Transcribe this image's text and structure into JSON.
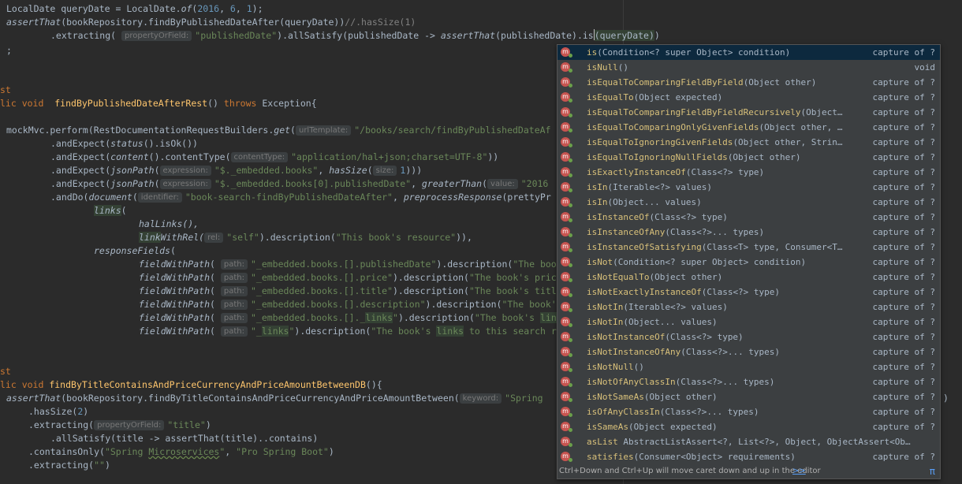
{
  "code": {
    "l1_a": "LocalDate queryDate = LocalDate.",
    "l1_b": "of",
    "l1_c": "(",
    "l1_n1": "2016",
    "l1_d": ", ",
    "l1_n2": "6",
    "l1_e": ", ",
    "l1_n3": "1",
    "l1_f": ");",
    "l2_a": "assertThat",
    "l2_b": "(bookRepository.findByPublishedDateAfter(queryDate))",
    "l2_c": "//.hasSize(1)",
    "l3_a": ".extracting(",
    "l3_hint": "propertyOrField:",
    "l3_str": "\"publishedDate\"",
    "l3_b": ").allSatisfy(publishedDate -> ",
    "l3_c": "assertThat",
    "l3_d": "(publishedDate).is",
    "l3_e": "(queryDate)",
    "l3_f": ")",
    "l4": ";",
    "l6": "st",
    "l7_kw": "lic void",
    "l7_fn": "findByPublishedDateAfterRest",
    "l7_a": "() ",
    "l7_kw2": "throws",
    "l7_b": " Exception{",
    "l9_a": "mockMvc",
    "l9_b": ".perform(RestDocumentationRequestBuilders.",
    "l9_c": "get",
    "l9_d": "(",
    "l9_hint": "urlTemplate:",
    "l9_str": "\"/books/search/findByPublishedDateAf",
    "l10_a": ".andExpect(",
    "l10_b": "status",
    "l10_c": "().isOk())",
    "l11_a": ".andExpect(",
    "l11_b": "content",
    "l11_c": "().contentType(",
    "l11_hint": "contentType:",
    "l11_str": "\"application/hal+json;charset=UTF-8\"",
    "l11_d": "))",
    "l12_a": ".andExpect(",
    "l12_b": "jsonPath",
    "l12_c": "(",
    "l12_hint": "expression:",
    "l12_str": "\"$._embedded.books\"",
    "l12_d": ", ",
    "l12_e": "hasSize",
    "l12_f": "(",
    "l12_hint2": "size:",
    "l12_num": "1",
    "l12_g": ")))",
    "l13_a": ".andExpect(",
    "l13_b": "jsonPath",
    "l13_c": "(",
    "l13_hint": "expression:",
    "l13_str": "\"$._embedded.books[0].publishedDate\"",
    "l13_d": ", ",
    "l13_e": "greaterThan",
    "l13_f": "(",
    "l13_hint2": "value:",
    "l13_str2": "\"2016",
    "l14_a": ".andDo(",
    "l14_b": "document",
    "l14_c": "(",
    "l14_hint": "identifier:",
    "l14_str": "\"book-search-findByPublishedDateAfter\"",
    "l14_d": ", ",
    "l14_e": "preprocessResponse",
    "l14_f": "(prettyPr",
    "l15_a": "links",
    "l15_b": "(",
    "l16": "halLinks(),",
    "l17_a": "link",
    "l17_b": "WithRel(",
    "l17_hint": "rel:",
    "l17_str": "\"self\"",
    "l17_c": ").description(",
    "l17_str2": "\"This book's resource\"",
    "l17_d": ")),",
    "l18_a": "responseFields",
    "l18_b": "(",
    "fwp": "fieldWithPath",
    "path_hint": "path:",
    "desc": ").description(",
    "l19_str": "\"_embedded.books.[].publishedDate\"",
    "l19_s2": "\"The boo",
    "l20_str": "\"_embedded.books.[].price\"",
    "l20_s2": "\"The book's pric",
    "l21_str": "\"_embedded.books.[].title\"",
    "l21_s2": "\"The book's titl",
    "l22_str": "\"_embedded.books.[].description\"",
    "l22_s2": "\"The book'",
    "l23_str_a": "\"_embedded.books.[]._",
    "l23_str_b": "links",
    "l23_str_c": "\"",
    "l23_s2a": "\"The book's ",
    "l23_s2b": "lin",
    "l24_str_a": "\"_",
    "l24_str_b": "links",
    "l24_str_c": "\"",
    "l24_s2a": "\"The book's ",
    "l24_s2b": "links",
    "l24_s2c": " to this search r",
    "l27": "st",
    "l28_kw": "lic void",
    "l28_fn": "findByTitleContainsAndPriceCurrencyAndPriceAmountBetweenDB",
    "l28_a": "(){",
    "l29_a": "assertThat",
    "l29_b": "(bookRepository.findByTitleContainsAndPriceCurrencyAndPriceAmountBetween(",
    "l29_hint": "keyword:",
    "l29_str": "\"Spring",
    "l29_end": ")",
    "l30_a": ".hasSize(",
    "l30_num": "2",
    "l30_b": ")",
    "l31_a": ".extracting(",
    "l31_hint": "propertyOrField:",
    "l31_str": "\"title\"",
    "l31_b": ")",
    "l32": ".allSatisfy(title -> assertThat(title)..contains)",
    "l33_a": ".containsOnly(",
    "l33_s1a": "\"Spring ",
    "l33_s1b": "Microservices",
    "l33_s1c": "\"",
    "l33_b": ", ",
    "l33_s2": "\"Pro Spring Boot\"",
    "l33_c": ")",
    "l34_a": ".extracting(",
    "l34_str": "\"\"",
    "l34_b": ")"
  },
  "completion": {
    "icon_letter": "m",
    "items": [
      {
        "name": "is",
        "params": "(Condition<? super Object> condition)",
        "type": "capture of ?"
      },
      {
        "name": "isNull",
        "params": "()",
        "type": "void"
      },
      {
        "name": "isEqualToComparingFieldByField",
        "params": "(Object other)",
        "type": "capture of ?"
      },
      {
        "name": "isEqualTo",
        "params": "(Object expected)",
        "type": "capture of ?"
      },
      {
        "name": "isEqualToComparingFieldByFieldRecursively",
        "params": "(Object…",
        "type": "capture of ?"
      },
      {
        "name": "isEqualToComparingOnlyGivenFields",
        "params": "(Object other, …",
        "type": "capture of ?"
      },
      {
        "name": "isEqualToIgnoringGivenFields",
        "params": "(Object other, Strin…",
        "type": "capture of ?"
      },
      {
        "name": "isEqualToIgnoringNullFields",
        "params": "(Object other)",
        "type": "capture of ?"
      },
      {
        "name": "isExactlyInstanceOf",
        "params": "(Class<?> type)",
        "type": "capture of ?"
      },
      {
        "name": "isIn",
        "params": "(Iterable<?> values)",
        "type": "capture of ?"
      },
      {
        "name": "isIn",
        "params": "(Object... values)",
        "type": "capture of ?"
      },
      {
        "name": "isInstanceOf",
        "params": "(Class<?> type)",
        "type": "capture of ?"
      },
      {
        "name": "isInstanceOfAny",
        "params": "(Class<?>... types)",
        "type": "capture of ?"
      },
      {
        "name": "isInstanceOfSatisfying",
        "params": "(Class<T> type, Consumer<T…",
        "type": "capture of ?"
      },
      {
        "name": "isNot",
        "params": "(Condition<? super Object> condition)",
        "type": "capture of ?"
      },
      {
        "name": "isNotEqualTo",
        "params": "(Object other)",
        "type": "capture of ?"
      },
      {
        "name": "isNotExactlyInstanceOf",
        "params": "(Class<?> type)",
        "type": "capture of ?"
      },
      {
        "name": "isNotIn",
        "params": "(Iterable<?> values)",
        "type": "capture of ?"
      },
      {
        "name": "isNotIn",
        "params": "(Object... values)",
        "type": "capture of ?"
      },
      {
        "name": "isNotInstanceOf",
        "params": "(Class<?> type)",
        "type": "capture of ?"
      },
      {
        "name": "isNotInstanceOfAny",
        "params": "(Class<?>... types)",
        "type": "capture of ?"
      },
      {
        "name": "isNotNull",
        "params": "()",
        "type": "capture of ?"
      },
      {
        "name": "isNotOfAnyClassIn",
        "params": "(Class<?>... types)",
        "type": "capture of ?"
      },
      {
        "name": "isNotSameAs",
        "params": "(Object other)",
        "type": "capture of ?"
      },
      {
        "name": "isOfAnyClassIn",
        "params": "(Class<?>... types)",
        "type": "capture of ?"
      },
      {
        "name": "isSameAs",
        "params": "(Object expected)",
        "type": "capture of ?"
      },
      {
        "name": "asList",
        "params": " AbstractListAssert<?, List<?>, Object, ObjectAssert<Ob…",
        "type": ""
      },
      {
        "name": "satisfies",
        "params": "(Consumer<Object> requirements)",
        "type": "capture of ?"
      }
    ],
    "footer_text": "Ctrl+Down and Ctrl+Up will move caret down and up in the editor",
    "footer_link": ">>",
    "footer_pi": "π"
  }
}
